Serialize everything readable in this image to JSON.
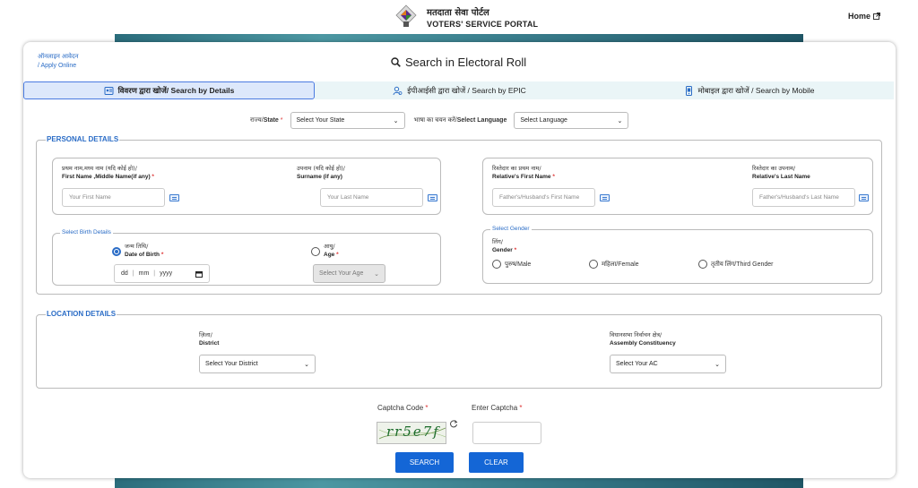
{
  "header": {
    "brand_hi": "मतदाता सेवा पोर्टल",
    "brand_en": "VOTERS' SERVICE PORTAL",
    "home_label": "Home"
  },
  "card": {
    "apply_online_hi": "ऑनलाइन आवेदन",
    "apply_online_en": "/ Apply Online",
    "title": "Search in Electoral Roll",
    "tabs": [
      {
        "label": "विवरण द्वारा खोजें/ Search by Details",
        "icon": "details-icon",
        "active": true
      },
      {
        "label": "ईपीआईसी द्वारा खोजें / Search by EPIC",
        "icon": "epic-icon",
        "active": false
      },
      {
        "label": "मोबाइल द्वारा खोजें / Search by Mobile",
        "icon": "mobile-icon",
        "active": false
      }
    ]
  },
  "state_row": {
    "state_label_hi": "राज्य/",
    "state_label_en": "State",
    "state_value": "Select Your State",
    "language_label_hi": "भाषा का चयन करें/",
    "language_label_en": "Select Language",
    "language_value": "Select Language"
  },
  "personal": {
    "legend": "PERSONAL DETAILS",
    "first_name_hi": "प्रथम नाम,मध्य नाम (यदि कोई हो)/",
    "first_name_en": "First Name ,Middle Name(if any)",
    "first_name_placeholder": "Your First Name",
    "surname_hi": "उपनाम (यदि कोई हो)/",
    "surname_en": "Surname (if any)",
    "surname_placeholder": "Your Last Name",
    "rel_first_hi": "रिश्तेदार का प्रथम नाम/",
    "rel_first_en": "Relative's First Name",
    "rel_first_placeholder": "Father's/Husband's First Name",
    "rel_last_hi": "रिश्तेदार का उपनाम/",
    "rel_last_en": "Relative's Last Name",
    "rel_last_placeholder": "Father's/Husband's Last Name",
    "birth_legend": "Select Birth Details",
    "dob_hi": "जन्म तिथि/",
    "dob_en": "Date of Birth",
    "dob_dd": "dd",
    "dob_mm": "mm",
    "dob_yyyy": "yyyy",
    "age_hi": "आयु/",
    "age_en": "Age",
    "age_value": "Select Your Age",
    "gender_legend": "Select Gender",
    "gender_hi": "लिंग/",
    "gender_en": "Gender",
    "gender_options": [
      "पुरुष/Male",
      "महिला/Female",
      "तृतीय लिंग/Third Gender"
    ]
  },
  "location": {
    "legend": "LOCATION DETAILS",
    "district_hi": "ज़िला/",
    "district_en": "District",
    "district_value": "Select Your District",
    "ac_hi": "विधानसभा निर्वाचन क्षेत्र/",
    "ac_en": "Assembly Constituency",
    "ac_value": "Select Your AC"
  },
  "captcha": {
    "code_label": "Captcha Code",
    "enter_label": "Enter Captcha",
    "image_text": "rr5e7f"
  },
  "actions": {
    "search": "SEARCH",
    "clear": "CLEAR"
  },
  "colors": {
    "accent": "#2a6cc6",
    "button": "#1466d6",
    "required": "#dd3333"
  }
}
